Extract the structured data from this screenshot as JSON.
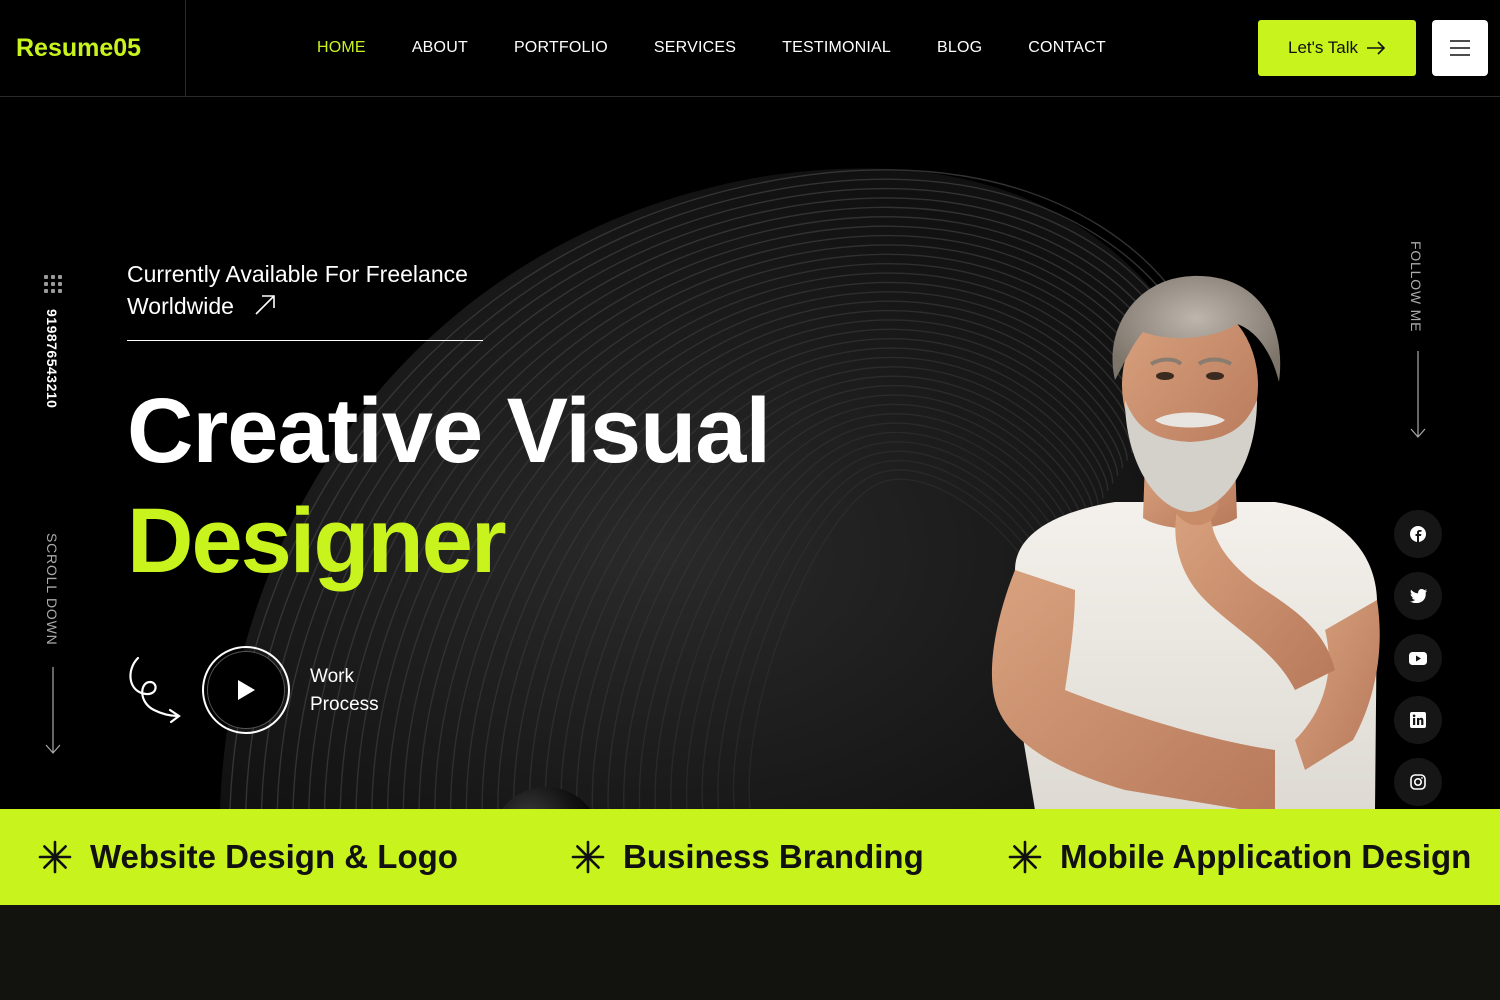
{
  "brand": {
    "logo": "Resume05",
    "accent": "#c8f31d"
  },
  "nav": {
    "items": [
      {
        "label": "HOME",
        "active": true
      },
      {
        "label": "ABOUT"
      },
      {
        "label": "PORTFOLIO"
      },
      {
        "label": "SERVICES"
      },
      {
        "label": "TESTIMONIAL"
      },
      {
        "label": "BLOG"
      },
      {
        "label": "CONTACT"
      }
    ],
    "cta_label": "Let's Talk"
  },
  "sidebar": {
    "phone": "919876543210",
    "scroll_label": "SCROLL DOWN",
    "follow_label": "FOLLOW ME",
    "socials": [
      "facebook-icon",
      "twitter-icon",
      "youtube-icon",
      "linkedin-icon",
      "instagram-icon"
    ]
  },
  "hero": {
    "availability": "Currently Available For Freelance Worldwide",
    "title_line1": "Creative Visual",
    "title_line2": "Designer",
    "work_label": "Work Process"
  },
  "services_band": {
    "items": [
      "Website Design & Logo",
      "Business Branding",
      "Mobile Application Design"
    ]
  }
}
